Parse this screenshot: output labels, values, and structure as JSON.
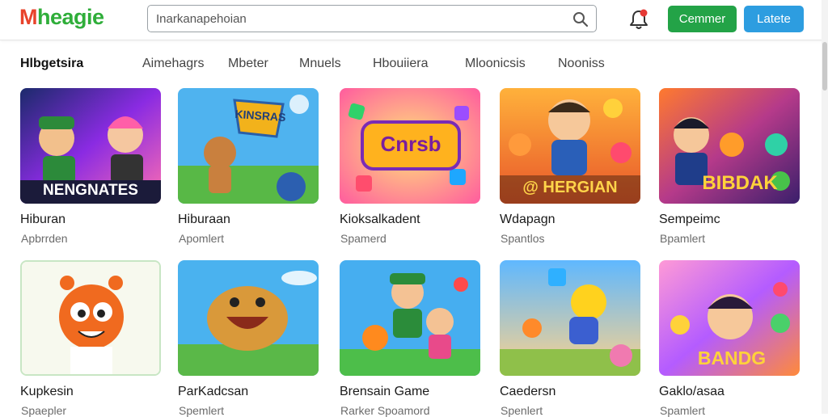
{
  "header": {
    "logo_first": "M",
    "logo_rest": "heagie",
    "search": {
      "value": "Inarkanapehoian",
      "icon": "search-icon"
    },
    "notification_icon": "bell-icon",
    "primary_button": "Cemmer",
    "secondary_button": "Latete",
    "colors": {
      "primary": "#23a347",
      "secondary": "#2d9de0",
      "logo_m": "#e8432b",
      "logo_rest": "#2fae3a"
    }
  },
  "tabs": [
    "Hlbgetsira",
    "Aimehagrs",
    "Mbeter",
    "Mnuels",
    "Hbouiiera",
    "Mloonicsis",
    "Nooniss"
  ],
  "active_tab": "Hlbgetsira",
  "cards": [
    {
      "title": "Hiburan",
      "subtitle": "Apbrrden",
      "banner": "NENGNATES"
    },
    {
      "title": "Hiburaan",
      "subtitle": "Apomlert",
      "banner": "KINSRAS"
    },
    {
      "title": "Kioksalkadent",
      "subtitle": "Spamerd",
      "banner": "Cnrsb"
    },
    {
      "title": "Wdapagn",
      "subtitle": "Spantlos",
      "banner": "@ HERGIAN"
    },
    {
      "title": "Sempeimc",
      "subtitle": "Bpamlert",
      "banner": "BIBDAK"
    },
    {
      "title": "Kupkesin",
      "subtitle": "Spaepler",
      "banner": ""
    },
    {
      "title": "ParKadcsan",
      "subtitle": "Spemlert",
      "banner": ""
    },
    {
      "title": "Brensain Game",
      "subtitle": "Rarker Spoamord",
      "banner": ""
    },
    {
      "title": "Caedersn",
      "subtitle": "Spenlert",
      "banner": ""
    },
    {
      "title": "Gaklo/asaa",
      "subtitle": "Spamlert",
      "banner": "BANDG"
    }
  ]
}
